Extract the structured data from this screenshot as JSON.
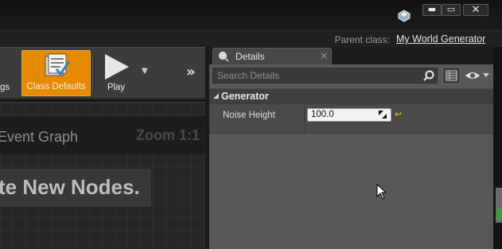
{
  "window": {
    "min_label": "▬",
    "max_label": "▭",
    "close_label": "✕",
    "parent_class_label": "Parent class:",
    "parent_class_value": "My World Generator"
  },
  "toolbar": {
    "settings_label": "gs",
    "class_defaults_label": "Class Defaults",
    "play_label": "Play",
    "play_dropdown": "▼",
    "more": "»"
  },
  "graph": {
    "title": "Event Graph",
    "zoom": "Zoom 1:1",
    "hint": "te New Nodes."
  },
  "details": {
    "tab_label": "Details",
    "tab_close": "×",
    "search_placeholder": "Search Details",
    "category_arrow": "◢",
    "category_label": "Generator",
    "property_name": "Noise Height",
    "property_value": "100.0",
    "reset_label": "↩"
  },
  "colors": {
    "accent_class_defaults": "#e68a00",
    "panel_bg": "#575757",
    "reset_yellow": "#c8b23a"
  }
}
